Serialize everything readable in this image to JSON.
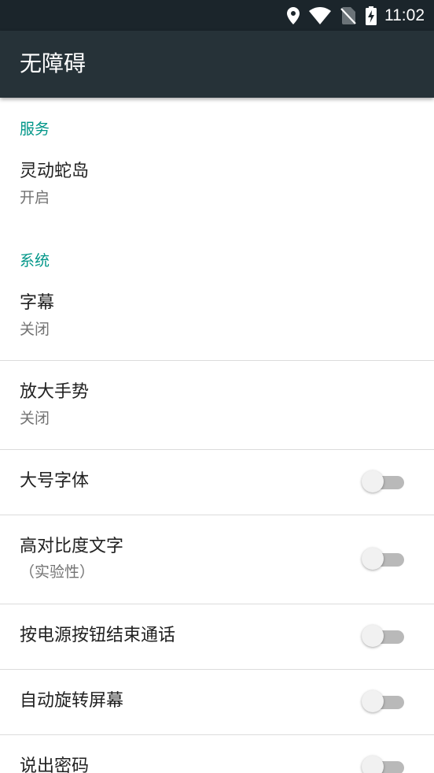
{
  "status_bar": {
    "time": "11:02",
    "icons": [
      "location-icon",
      "wifi-icon",
      "no-sim-icon",
      "battery-charging-icon"
    ]
  },
  "app_bar": {
    "title": "无障碍"
  },
  "sections": {
    "services": {
      "header": "服务",
      "items": [
        {
          "title": "灵动蛇岛",
          "summary": "开启"
        }
      ]
    },
    "system": {
      "header": "系统",
      "items": [
        {
          "title": "字幕",
          "summary": "关闭"
        },
        {
          "title": "放大手势",
          "summary": "关闭"
        },
        {
          "title": "大号字体",
          "toggle": false
        },
        {
          "title": "高对比度文字",
          "summary": "（实验性）",
          "toggle": false
        },
        {
          "title": "按电源按钮结束通话",
          "toggle": false
        },
        {
          "title": "自动旋转屏幕",
          "toggle": false
        },
        {
          "title": "说出密码",
          "toggle": false
        }
      ]
    }
  },
  "colors": {
    "status_bar": "#1b252b",
    "app_bar": "#263238",
    "accent": "#009688",
    "divider": "#dcdcdc",
    "switch_track_off": "#b9b9b9",
    "switch_thumb_off": "#f1f1f1"
  }
}
